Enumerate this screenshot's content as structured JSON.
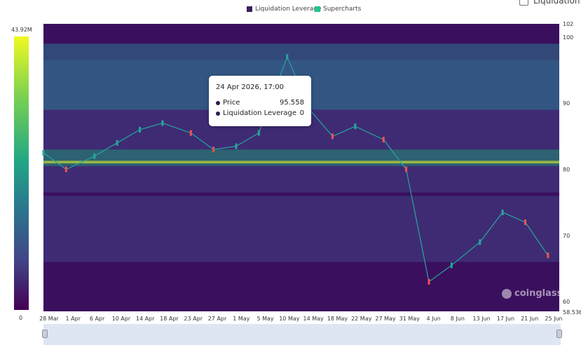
{
  "legend": {
    "items": [
      {
        "label": "Liquidation Leverage",
        "color": "#3b1f5c"
      },
      {
        "label": "Supercharts",
        "color": "#22c38e"
      }
    ],
    "checkbox_label": "Liquidation M"
  },
  "colorbar": {
    "max_label": "43.92M",
    "min_label": "0",
    "colors": [
      "#f0f921",
      "#7ad151",
      "#22a884",
      "#2a788e",
      "#414487",
      "#440154"
    ]
  },
  "tooltip": {
    "date": "24 Apr 2026, 17:00",
    "rows": [
      {
        "label": "Price",
        "value": "95.558",
        "dot_color": "#2d1b4e"
      },
      {
        "label": "Liquidation Leverage",
        "value": "0",
        "dot_color": "#2d1b4e"
      }
    ]
  },
  "watermark": "coinglass",
  "chart_data": {
    "type": "heatmap",
    "title": "",
    "x_tick_labels": [
      "28 Mar",
      "1 Apr",
      "6 Apr",
      "10 Apr",
      "14 Apr",
      "18 Apr",
      "23 Apr",
      "27 Apr",
      "1 May",
      "5 May",
      "10 May",
      "14 May",
      "18 May",
      "22 May",
      "27 May",
      "31 May",
      "4 Jun",
      "8 Jun",
      "13 Jun",
      "17 Jun",
      "21 Jun",
      "25 Jun"
    ],
    "y_tick_labels": [
      "102",
      "100",
      "90",
      "80",
      "70",
      "60",
      "58.536"
    ],
    "y_ticks": [
      102,
      100,
      90,
      80,
      70,
      60,
      58.536
    ],
    "ylim": [
      58.536,
      102
    ],
    "grid": false,
    "legend_position": "top-center",
    "series": [
      {
        "name": "Supercharts",
        "kind": "candlestick",
        "dates": [
          "2026-03-28",
          "2026-04-01",
          "2026-04-06",
          "2026-04-10",
          "2026-04-14",
          "2026-04-18",
          "2026-04-23",
          "2026-04-27",
          "2026-05-01",
          "2026-05-05",
          "2026-05-10",
          "2026-05-14",
          "2026-05-18",
          "2026-05-22",
          "2026-05-27",
          "2026-05-31",
          "2026-06-04",
          "2026-06-08",
          "2026-06-13",
          "2026-06-17",
          "2026-06-21",
          "2026-06-25"
        ],
        "close": [
          82.5,
          80.0,
          82.0,
          84.0,
          86.0,
          87.0,
          85.5,
          83.0,
          83.5,
          85.5,
          97.0,
          89.0,
          85.0,
          86.5,
          84.5,
          80.0,
          63.0,
          65.5,
          69.0,
          73.5,
          72.0,
          67.0
        ]
      },
      {
        "name": "Liquidation Leverage",
        "kind": "heatmap",
        "max": "43.92M",
        "min": "0",
        "bands": [
          {
            "low": 83.0,
            "high": 96.5,
            "intensity": 0.25
          },
          {
            "low": 80.5,
            "high": 83.0,
            "intensity": 0.45
          },
          {
            "low": 80.9,
            "high": 81.3,
            "intensity": 0.9
          },
          {
            "low": 76.5,
            "high": 80.5,
            "intensity": 0.2
          },
          {
            "low": 89.0,
            "high": 99.0,
            "intensity": 0.3
          },
          {
            "low": 66.0,
            "high": 76.0,
            "intensity": 0.22
          }
        ]
      }
    ]
  }
}
